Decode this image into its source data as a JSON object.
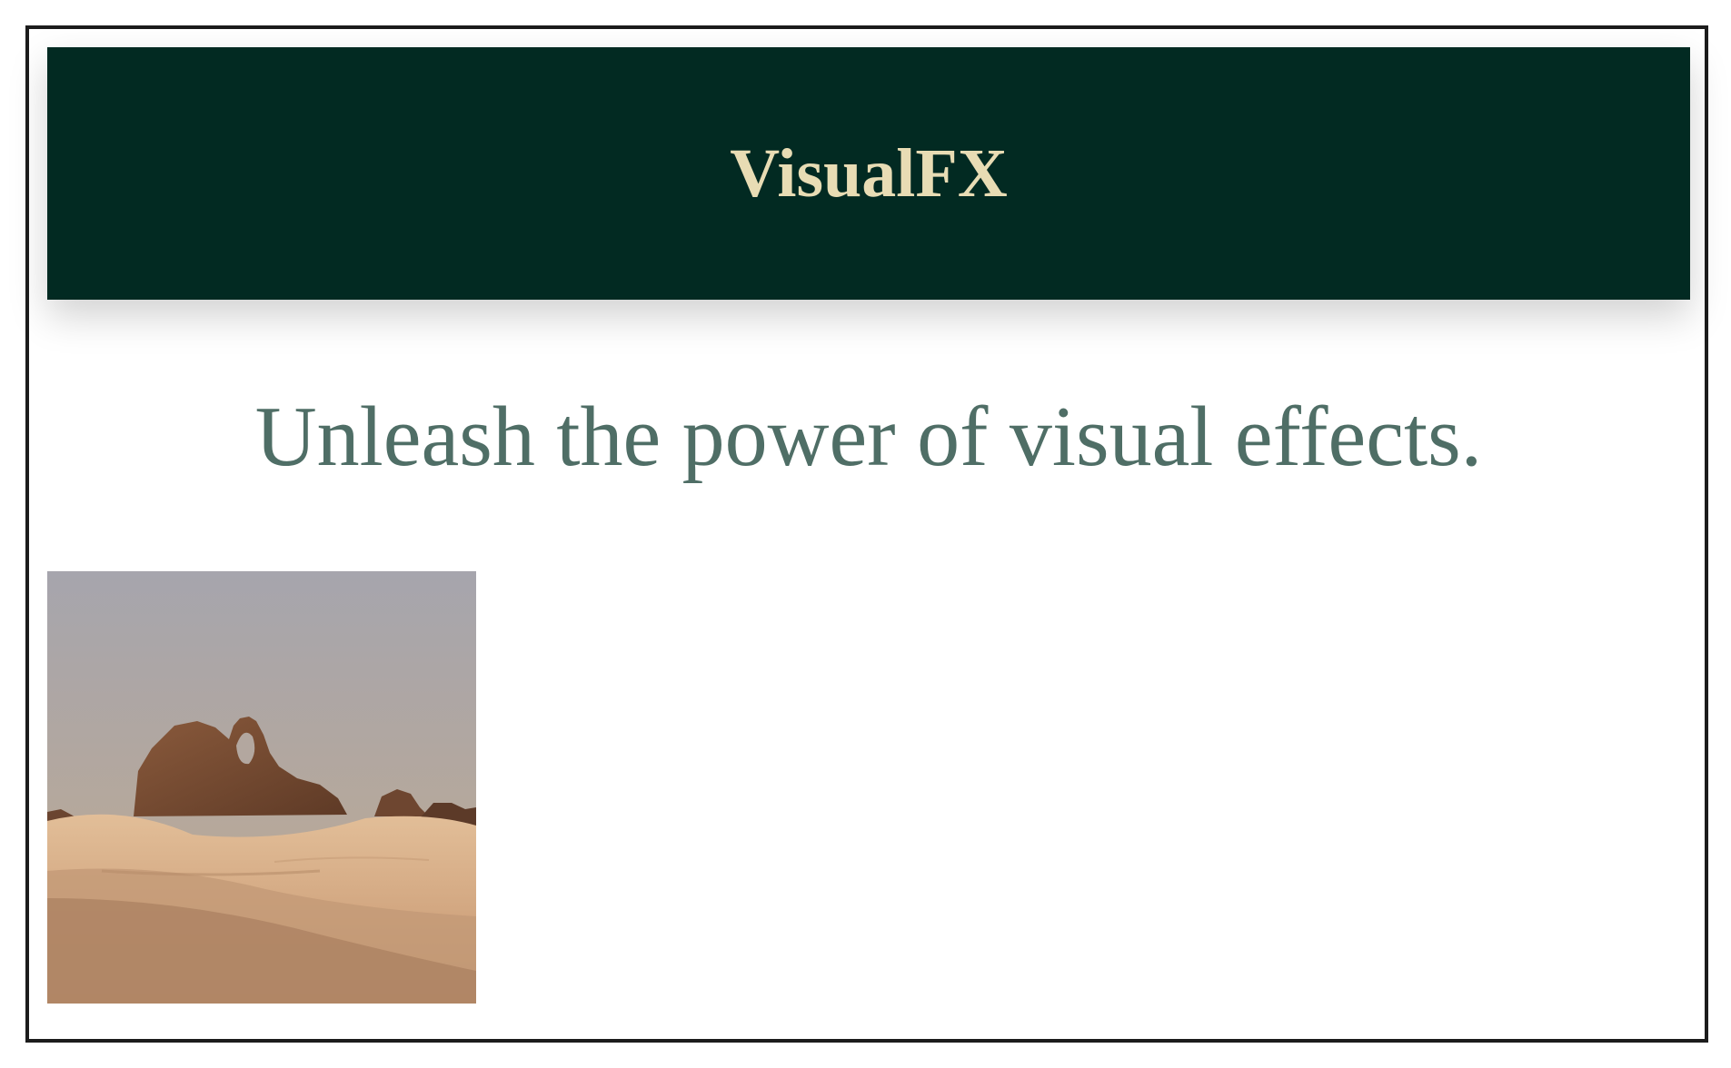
{
  "header": {
    "brand": "VisualFX"
  },
  "hero": {
    "tagline": "Unleash the power of visual effects."
  },
  "image": {
    "subject": "desert-landscape-with-rock-arch"
  },
  "colors": {
    "header_bg": "#022a22",
    "brand_text": "#e8dcb4",
    "tagline_text": "#4f6e66",
    "page_bg": "#ffffff"
  }
}
